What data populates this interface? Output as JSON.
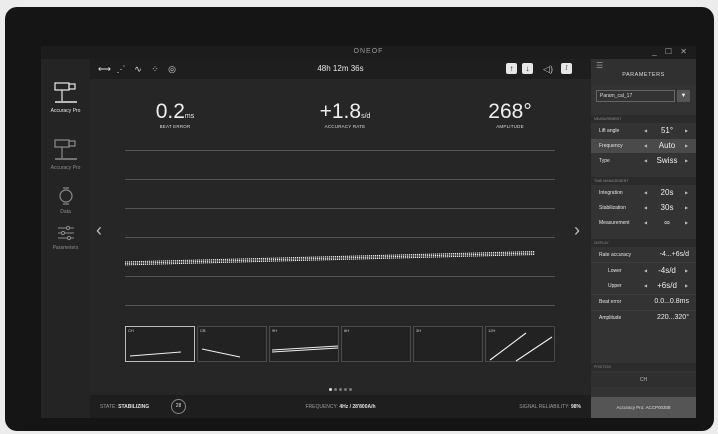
{
  "window": {
    "title": "ONEOF",
    "controls": "_ ☐ ✕"
  },
  "nav": {
    "items": [
      {
        "label": "Accuracy Pro",
        "active": true,
        "icon": "timegrapher-icon"
      },
      {
        "label": "Accuracy Pro",
        "active": false,
        "icon": "timegrapher-icon"
      },
      {
        "label": "Data",
        "active": false,
        "icon": "watch-icon"
      },
      {
        "label": "Parameters",
        "active": false,
        "icon": "sliders-icon"
      }
    ]
  },
  "toolbar": {
    "timer": "48h 12m 36s",
    "icons": [
      "arrows-horizontal-icon",
      "trace-icon",
      "wave-icon",
      "scatter-icon",
      "target-icon"
    ],
    "right_icons": [
      "upload-icon",
      "download-icon",
      "volume-icon",
      "microphone-icon"
    ]
  },
  "metrics": {
    "beat_error": {
      "value": "0.2",
      "unit": "ms",
      "label": "BEAT ERROR"
    },
    "accuracy_rate": {
      "value": "+1.8",
      "unit": "s/d",
      "label": "ACCURACY RATE"
    },
    "amplitude": {
      "value": "268°",
      "unit": "",
      "label": "AMPLITUDE"
    }
  },
  "chart_data": {
    "type": "line",
    "title": "",
    "xlabel": "",
    "ylabel": "",
    "grid": true,
    "series": [
      {
        "x": [
          0,
          1
        ],
        "values": [
          -0.08,
          0.05
        ]
      }
    ]
  },
  "thumbnails": [
    {
      "label": "CH",
      "active": true,
      "lines": 1
    },
    {
      "label": "CB",
      "active": false,
      "lines": 1
    },
    {
      "label": "9H",
      "active": false,
      "lines": 2
    },
    {
      "label": "6H",
      "active": false,
      "lines": 0
    },
    {
      "label": "3H",
      "active": false,
      "lines": 0
    },
    {
      "label": "12H",
      "active": false,
      "lines": 2
    }
  ],
  "pager": {
    "count": 5,
    "active": 0
  },
  "status": {
    "state_prefix": "STATE:",
    "state": "STABILIZING",
    "badge": "28",
    "freq_prefix": "FREQUENCY:",
    "freq_value": "4Hz / 28'800A/h",
    "reliability_prefix": "SIGNAL RELIABILITY:",
    "reliability": "98%"
  },
  "panel": {
    "title": "PARAMETERS",
    "dropdown_value": "Param_cal_17",
    "sections": {
      "measurement": "MEASUREMENT",
      "time_management": "TIME MANAGEMENT",
      "display": "DISPLAY",
      "position": "POSITION"
    },
    "measurement": [
      {
        "label": "Lift angle",
        "value": "51°"
      },
      {
        "label": "Frequency",
        "value": "Auto"
      },
      {
        "label": "Type",
        "value": "Swiss"
      }
    ],
    "time": [
      {
        "label": "Integration",
        "value": "20s"
      },
      {
        "label": "Stabilization",
        "value": "30s"
      },
      {
        "label": "Measurement",
        "value": "∞"
      }
    ],
    "display": {
      "rate_label": "Rate accuracy",
      "rate_value": "-4...+6s/d",
      "lower_label": "Lower",
      "lower_value": "-4s/d",
      "upper_label": "Upper",
      "upper_value": "+6s/d",
      "beat_label": "Beat error",
      "beat_value": "0.0...0.8ms",
      "amp_label": "Amplitude",
      "amp_value": "220...320°"
    },
    "position_value": "CH",
    "footer": "Accuracy Pro: ACCP00308"
  }
}
